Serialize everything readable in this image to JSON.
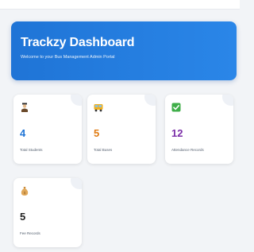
{
  "banner": {
    "title": "Trackzy Dashboard",
    "subtitle": "Welcome to your Bus Management Admin Portal"
  },
  "cards": [
    {
      "icon": "student-icon",
      "value": "4",
      "label": "Total Students",
      "value_color": "#1f74d6"
    },
    {
      "icon": "bus-icon",
      "value": "5",
      "label": "Total Buses",
      "value_color": "#e07b12"
    },
    {
      "icon": "check-icon",
      "value": "12",
      "label": "Attendance Records",
      "value_color": "#7b2fa8"
    },
    {
      "icon": "money-bag-icon",
      "value": "5",
      "label": "Fee Records",
      "value_color": "#222222"
    }
  ]
}
